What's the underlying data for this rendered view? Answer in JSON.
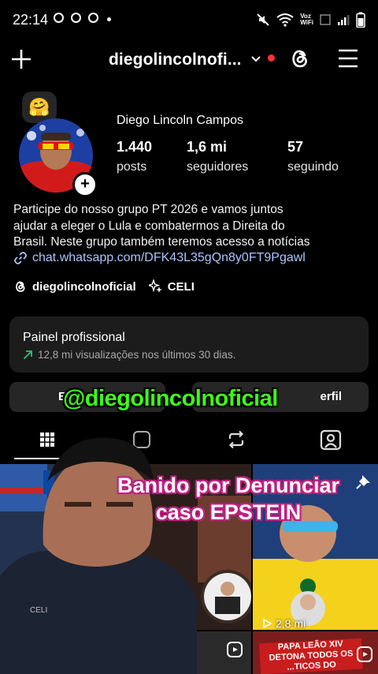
{
  "status_bar": {
    "time": "22:14",
    "network_label_top": "Voz",
    "network_label_bottom": "WiFi"
  },
  "header": {
    "username": "diegolincolnofi..."
  },
  "profile": {
    "full_name": "Diego Lincoln Campos",
    "note_emoji": "🤗",
    "stats": [
      {
        "value": "1.440",
        "label": "posts"
      },
      {
        "value": "1,6 mi",
        "label": "seguidores"
      },
      {
        "value": "57",
        "label": "seguindo"
      }
    ],
    "bio_lines": [
      "Participe do nosso grupo PT 2026 e vamos juntos",
      "ajudar a eleger o Lula e combatermos a Direita do",
      "Brasil. Neste grupo também teremos acesso a notícias"
    ],
    "link": "chat.whatsapp.com/DFK43L35gQn8y0FT9Pgawl",
    "tags": [
      {
        "icon": "threads-icon",
        "label": "diegolincolnoficial"
      },
      {
        "icon": "sparkle-icon",
        "label": "CELI"
      }
    ]
  },
  "pro_panel": {
    "title": "Painel profissional",
    "subtitle": "12,8 mi visualizações nos últimos 30 dias."
  },
  "buttons": {
    "edit_label": "E",
    "share_label": "erfil"
  },
  "overlays": {
    "handle": "@diegolincolnoficial",
    "caption_line1": "Banido por Denunciar",
    "caption_line2": "caso EPSTEIN",
    "shirt_text": "CELI"
  },
  "grid": {
    "view_count": "2,8 mi",
    "thumb_caption_line1": "PAPA LEÃO XIV",
    "thumb_caption_line2": "DETONA TODOS OS",
    "thumb_caption_line3": "...TICOS DO"
  },
  "colors": {
    "accent_green": "#3dfc17",
    "link_blue": "#a9c4ff",
    "notif_red": "#ff3040"
  }
}
